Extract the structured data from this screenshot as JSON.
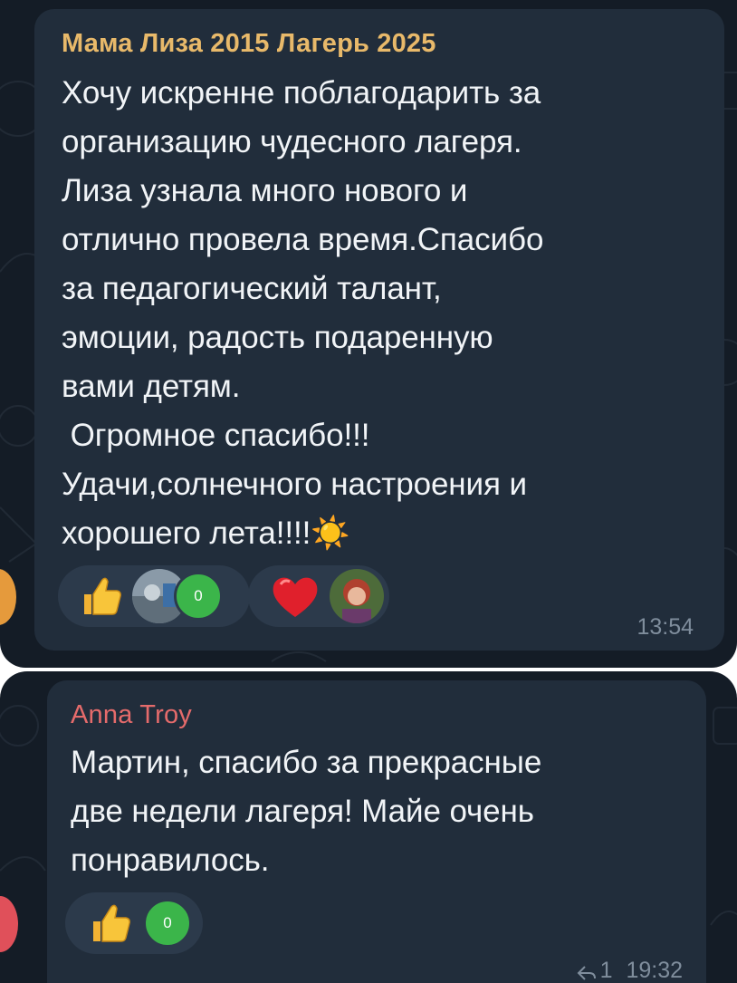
{
  "messages": [
    {
      "author": "Мама Лиза 2015 Лагерь 2025",
      "author_color": "#e8b96a",
      "text": "Хочу искренне поблагодарить за\nорганизацию чудесного лагеря.\nЛиза узнала много нового и\nотлично провела время.Спасибо\nза педагогический талант,\nэмоции, радость подаренную\nвами детям.\n Огромное спасибо!!!\nУдачи,солнечного настроения и\nхорошего лета!!!!☀️",
      "reactions": [
        {
          "emoji_icon": "thumbs-up-icon",
          "count": "0"
        },
        {
          "emoji_icon": "red-heart-icon"
        }
      ],
      "time": "13:54"
    },
    {
      "author": "Anna Troy",
      "author_color": "#e56b6b",
      "text": "Мартин, спасибо за прекрасные\nдве недели лагеря! Майе очень\nпонравилось.",
      "reactions": [
        {
          "emoji_icon": "thumbs-up-icon",
          "count": "0"
        }
      ],
      "reply_count": "1",
      "time": "19:32"
    }
  ],
  "colors": {
    "background": "#141c26",
    "bubble": "#212d3b",
    "reaction_pill": "#2c3a4b",
    "badge_green": "#3bb54a",
    "text": "#f1f4f7",
    "meta": "#7f8d9c"
  }
}
